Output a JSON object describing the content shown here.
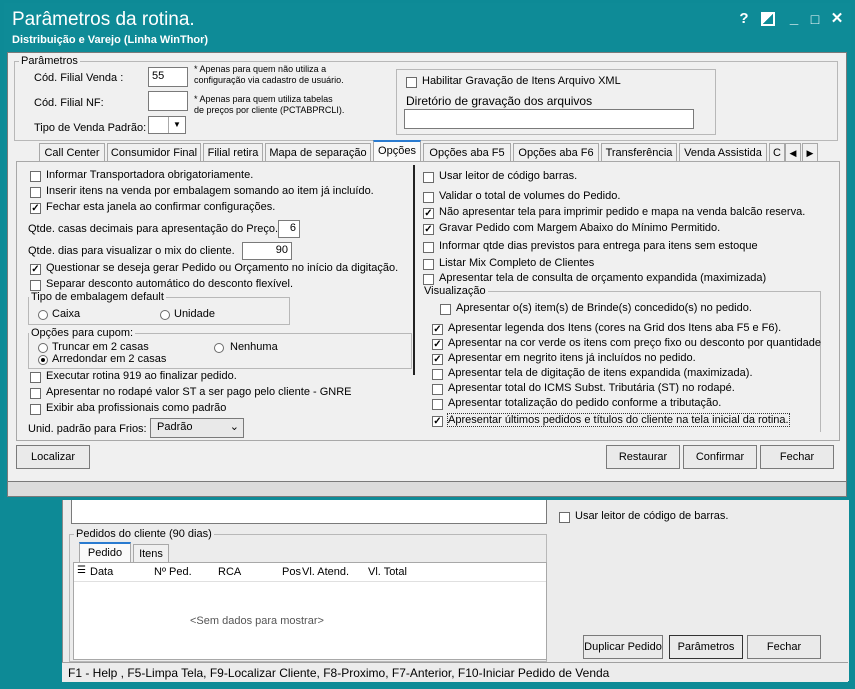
{
  "dialog": {
    "title": "Parâmetros da rotina.",
    "subtitle": "Distribuição e Varejo (Linha WinThor)",
    "controls": {
      "help": "?",
      "restore": "▪",
      "minimize": "_",
      "maximize": "□",
      "close": "✕"
    }
  },
  "params": {
    "group_label": "Parâmetros",
    "filial_venda_label": "Cód. Filial Venda :",
    "filial_venda_value": "55",
    "filial_venda_note1": "* Apenas para quem não utiliza a",
    "filial_venda_note2": "configuração via cadastro de usuário.",
    "filial_nf_label": "Cód. Filial NF:",
    "filial_nf_value": "",
    "filial_nf_note1": "* Apenas para quem utiliza tabelas",
    "filial_nf_note2": "de preços por cliente (PCTABPRCLI).",
    "tipo_venda_label": "Tipo de Venda Padrão:",
    "tipo_venda_value": "",
    "xml_label": "Habilitar Gravação de Itens Arquivo XML",
    "dir_label": "Diretório de gravação dos arquivos",
    "dir_value": ""
  },
  "tabs": [
    "Call Center",
    "Consumidor Final",
    "Filial retira",
    "Mapa de separação",
    "Opções",
    "Opções aba F5",
    "Opções aba F6",
    "Transferência",
    "Venda Assistida",
    "C"
  ],
  "left": {
    "c1": "Informar Transportadora obrigatoriamente.",
    "c2": "Inserir itens na venda por embalagem somando ao item já incluído.",
    "c3": "Fechar esta janela ao confirmar configurações.",
    "decimais_label": "Qtde. casas decimais para apresentação do Preço.",
    "decimais_value": "6",
    "dias_label": "Qtde. dias para visualizar o mix do cliente.",
    "dias_value": "90",
    "c4": "Questionar se deseja gerar Pedido ou Orçamento no início da digitação.",
    "c5": "Separar desconto automático do desconto flexível.",
    "emb_group": "Tipo de embalagem default",
    "emb_caixa": "Caixa",
    "emb_unidade": "Unidade",
    "cupom_group": "Opções para cupom:",
    "cupom_truncar": "Truncar em 2 casas",
    "cupom_nenhuma": "Nenhuma",
    "cupom_arredondar": "Arredondar em 2 casas",
    "c6": "Executar rotina 919 ao finalizar pedido.",
    "c7": "Apresentar no rodapé valor ST a ser pago pelo cliente - GNRE",
    "c8": "Exibir aba profissionais como padrão",
    "frios_label": "Unid. padrão para Frios:",
    "frios_value": "Padrão"
  },
  "right": {
    "r1": "Usar leitor de código barras.",
    "r2": "Validar o total de volumes do Pedido.",
    "r3": "Não apresentar tela para imprimir pedido e mapa na venda balcão reserva.",
    "r4": "Gravar Pedido com Margem Abaixo do Mínimo Permitido.",
    "r5": "Informar qtde dias previstos para entrega para itens sem estoque",
    "r6": "Listar Mix Completo de Clientes",
    "r7": "Apresentar tela de consulta de orçamento expandida (maximizada)",
    "vis_group": "Visualização",
    "v1": "Apresentar o(s) item(s) de Brinde(s) concedido(s) no pedido.",
    "v2": "Apresentar legenda dos Itens (cores na Grid dos Itens aba F5 e F6).",
    "v3": "Apresentar na cor verde os itens com preço fixo ou desconto por quantidade",
    "v4": "Apresentar em negrito itens já incluídos no pedido.",
    "v5": "Apresentar tela de digitação de itens expandida (maximizada).",
    "v6": "Apresentar total do ICMS Subst. Tributária (ST) no rodapé.",
    "v7": "Apresentar totalização do pedido conforme a tributação.",
    "v8": "Apresentar últimos pedidos e títulos do cliente na tela inicial da rotina."
  },
  "buttons": {
    "localizar": "Localizar",
    "restaurar": "Restaurar",
    "confirmar": "Confirmar",
    "fechar": "Fechar"
  },
  "background": {
    "barcode_label": "Usar leitor de código de barras.",
    "pedidos_group": "Pedidos do cliente (90 dias)",
    "tab_pedido": "Pedido",
    "tab_itens": "Itens",
    "columns": [
      "Data",
      "Nº Ped.",
      "RCA",
      "Pos",
      "Vl. Atend.",
      "Vl. Total"
    ],
    "empty": "<Sem dados para mostrar>",
    "btn_duplicar": "Duplicar Pedido",
    "btn_parametros": "Parâmetros",
    "btn_fechar": "Fechar",
    "status": "F1 - Help , F5-Limpa Tela, F9-Localizar Cliente, F8-Proximo, F7-Anterior, F10-Iniciar Pedido de Venda"
  },
  "colors": {
    "titlebar": "#0e8b97",
    "tab_accent": "#2a7bd0"
  }
}
